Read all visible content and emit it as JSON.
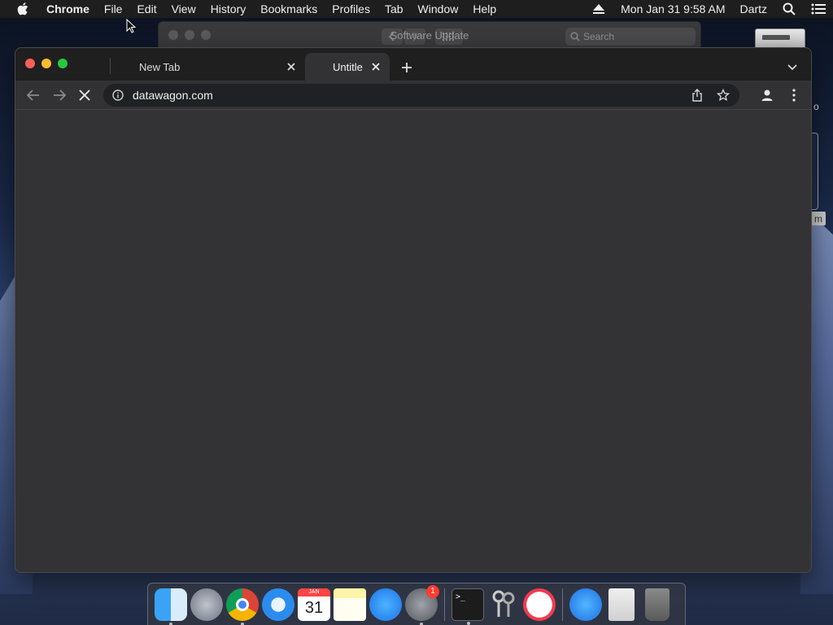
{
  "menubar": {
    "app_name": "Chrome",
    "items": [
      "File",
      "Edit",
      "View",
      "History",
      "Bookmarks",
      "Profiles",
      "Tab",
      "Window",
      "Help"
    ],
    "datetime": "Mon Jan 31  9:58 AM",
    "user": "Dartz"
  },
  "background_window": {
    "title": "Software Update",
    "search_placeholder": "Search"
  },
  "desktop_peek": {
    "m_label": "m",
    "o_label": "o"
  },
  "browser": {
    "tabs": [
      {
        "title": "New Tab",
        "active": false
      },
      {
        "title": "Untitle",
        "active": true
      }
    ],
    "url": "datawagon.com",
    "loading": true
  },
  "dock": {
    "apps": [
      {
        "name": "Finder",
        "running": true
      },
      {
        "name": "Launchpad",
        "running": false
      },
      {
        "name": "Google Chrome",
        "running": true
      },
      {
        "name": "Safari",
        "running": false
      },
      {
        "name": "Calendar",
        "running": false,
        "month": "JAN",
        "day": "31"
      },
      {
        "name": "Notes",
        "running": false
      },
      {
        "name": "App Store",
        "running": false
      },
      {
        "name": "System Preferences",
        "running": true,
        "badge": "1"
      },
      {
        "name": "Terminal",
        "running": true,
        "prompt": ">_"
      },
      {
        "name": "Keychain Access",
        "running": false
      },
      {
        "name": "News",
        "running": false
      },
      {
        "name": "App Store Download",
        "running": false
      },
      {
        "name": "Document",
        "running": false
      },
      {
        "name": "Trash",
        "running": false
      }
    ]
  },
  "colors": {
    "menubar_bg": "#1e1e1f",
    "chrome_toolbar_bg": "#323234",
    "omnibox_bg": "#202124",
    "close_light": "#ff5f57",
    "minimize_light": "#febc2e",
    "zoom_light": "#28c840"
  }
}
